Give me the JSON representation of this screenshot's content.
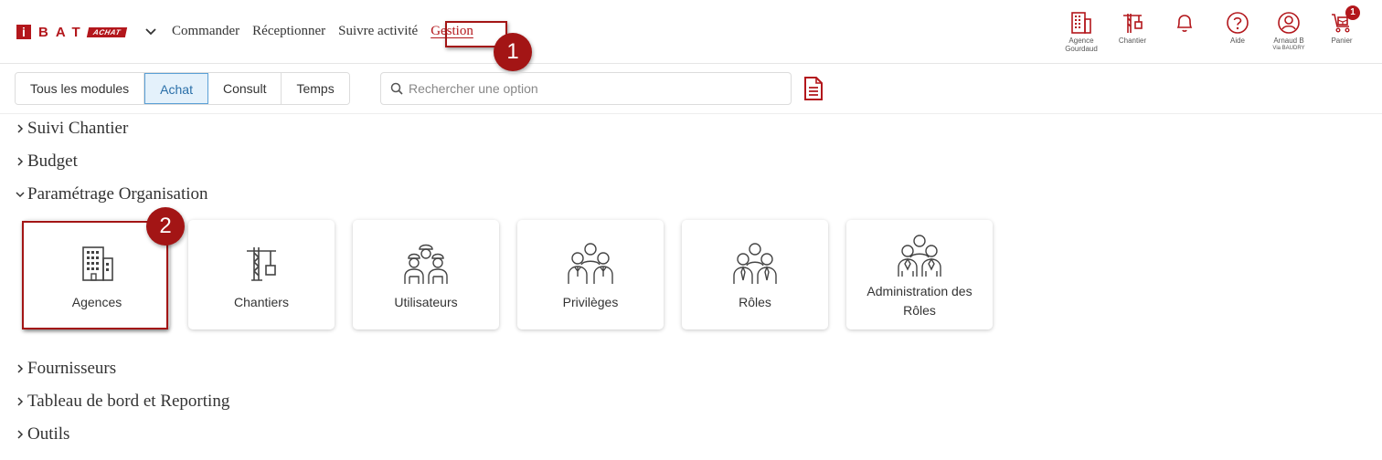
{
  "header": {
    "logo_letter": "i",
    "logo_letters": "BAT",
    "logo_badge": "ACHAT",
    "nav": [
      "Commander",
      "Réceptionner",
      "Suivre activité",
      "Gestion"
    ],
    "active_nav": "Gestion",
    "icons": [
      {
        "name": "building-icon",
        "label_lines": [
          "Agence",
          "Gourdaud"
        ]
      },
      {
        "name": "crane-icon",
        "label_lines": [
          "Chantier"
        ]
      },
      {
        "name": "bell-icon",
        "label_lines": [
          ""
        ]
      },
      {
        "name": "help-icon",
        "label_lines": [
          "Aide"
        ]
      },
      {
        "name": "user-icon",
        "label_lines": [
          "Arnaud B",
          "Via BAUDRY"
        ]
      },
      {
        "name": "cart-icon",
        "label_lines": [
          "Panier"
        ]
      }
    ],
    "cart_count": "1",
    "accent_color": "#b3171c"
  },
  "steps": {
    "step1": "1",
    "step2": "2"
  },
  "module_tabs": [
    "Tous les modules",
    "Achat",
    "Consult",
    "Temps"
  ],
  "selected_tab": "Achat",
  "search": {
    "placeholder": "Rechercher une option"
  },
  "sections": [
    {
      "label": "Suivi Chantier",
      "expanded": false
    },
    {
      "label": "Budget",
      "expanded": false
    },
    {
      "label": "Paramétrage Organisation",
      "expanded": true
    },
    {
      "label": "Fournisseurs",
      "expanded": false
    },
    {
      "label": "Tableau de bord et Reporting",
      "expanded": false
    },
    {
      "label": "Outils",
      "expanded": false
    }
  ],
  "cards": [
    {
      "label": "Agences",
      "icon": "building-icon"
    },
    {
      "label": "Chantiers",
      "icon": "crane-icon"
    },
    {
      "label": "Utilisateurs",
      "icon": "workers-icon"
    },
    {
      "label": "Privilèges",
      "icon": "team-icon"
    },
    {
      "label": "Rôles",
      "icon": "roles-icon"
    },
    {
      "label": "Administration des Rôles",
      "icon": "admin-roles-icon"
    }
  ]
}
